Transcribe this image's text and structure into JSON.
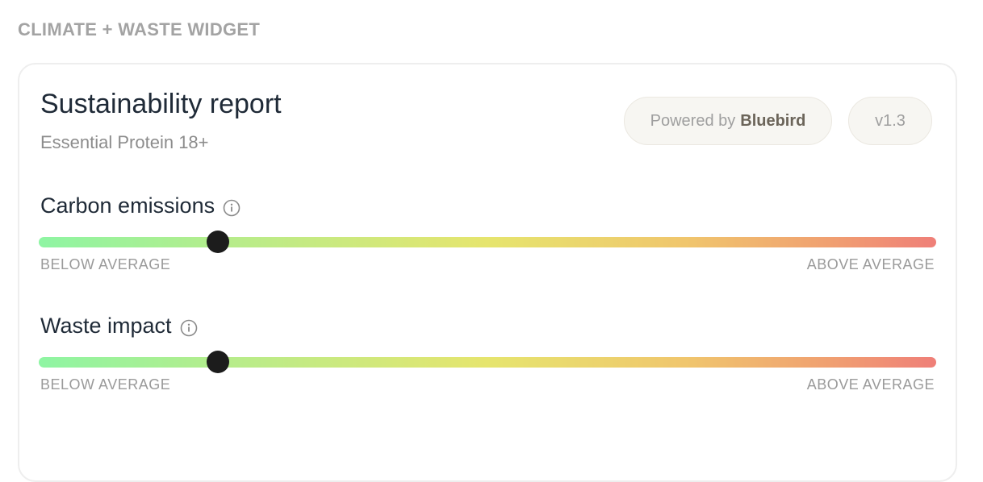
{
  "widget_label": "CLIMATE + WASTE WIDGET",
  "report": {
    "title": "Sustainability report",
    "subtitle": "Essential Protein 18+"
  },
  "badges": {
    "powered_prefix": "Powered by",
    "powered_brand": "Bluebird",
    "version": "v1.3"
  },
  "metrics": [
    {
      "label": "Carbon emissions",
      "icon": "info-icon",
      "value_fraction": 0.2,
      "low_label": "BELOW AVERAGE",
      "high_label": "ABOVE AVERAGE"
    },
    {
      "label": "Waste impact",
      "icon": "info-icon",
      "value_fraction": 0.2,
      "low_label": "BELOW AVERAGE",
      "high_label": "ABOVE AVERAGE"
    }
  ],
  "colors": {
    "gradient_low": "#8ef5a3",
    "gradient_mid": "#e6e56e",
    "gradient_high": "#ef7f78",
    "thumb": "#1c1c1c",
    "brand_text": "#6b6459"
  }
}
